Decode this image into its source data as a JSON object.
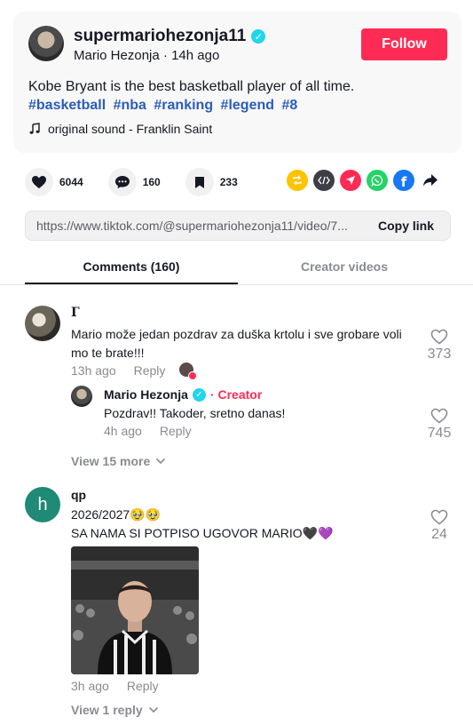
{
  "post": {
    "username": "supermariohezonja11",
    "display_name": "Mario Hezonja",
    "time_ago": "14h ago",
    "follow_label": "Follow",
    "caption": "Kobe Bryant is the best basketball player of all time.",
    "hashtags": [
      "#basketball",
      "#nba",
      "#ranking",
      "#legend",
      "#8"
    ],
    "sound": "original sound - Franklin Saint"
  },
  "actions": {
    "likes": "6044",
    "comments": "160",
    "saves": "233"
  },
  "share_icons": [
    "repost-icon",
    "embed-icon",
    "send-icon",
    "whatsapp-icon",
    "facebook-icon",
    "share-arrow-icon"
  ],
  "link": {
    "url": "https://www.tiktok.com/@supermariohezonja11/video/7...",
    "copy_label": "Copy link"
  },
  "tabs": {
    "comments": "Comments (160)",
    "creator": "Creator videos"
  },
  "comments": [
    {
      "author": "Г",
      "text": "Mario može jedan pozdrav za duška krtolu i sve grobare voli mo te brate!!!",
      "time": "13h ago",
      "reply_label": "Reply",
      "likes": "373",
      "reply": {
        "author": "Mario Hezonja",
        "creator_label": "Creator",
        "text": "Pozdrav!! Takoder, sretno danas!",
        "time": "4h ago",
        "reply_label": "Reply",
        "likes": "745"
      },
      "view_more": "View 15 more"
    },
    {
      "author": "qp",
      "avatar_letter": "h",
      "line1": "2026/2027🥹🥹",
      "line2": "SA NAMA SI POTPISO UGOVOR MARIO🖤💜",
      "time": "3h ago",
      "reply_label": "Reply",
      "likes": "24",
      "view_more": "View 1 reply"
    }
  ],
  "colors": {
    "accent": "#fe2c55",
    "hashtag": "#2b5db9",
    "verified": "#20d5ec",
    "avatar_h": "#1f8a76"
  }
}
